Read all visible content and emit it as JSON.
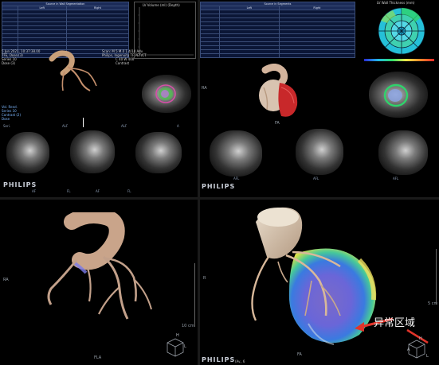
{
  "colors": {
    "background": "#000000",
    "table_bg": "#0b1636",
    "table_header": "#1b2b58",
    "annotation_arrow": "#e0342a",
    "annotation_text": "#ffffff"
  },
  "top_left": {
    "table_title": "Source in Wall Segmentation",
    "table_columns": [
      "",
      "Left",
      "Right"
    ],
    "table_rows": [
      [
        "",
        "",
        ""
      ],
      [
        "",
        "",
        ""
      ],
      [
        "",
        "",
        ""
      ],
      [
        "",
        "",
        ""
      ],
      [
        "",
        "",
        ""
      ],
      [
        "",
        "",
        ""
      ],
      [
        "",
        "",
        ""
      ],
      [
        "",
        "",
        ""
      ],
      [
        "",
        "",
        ""
      ],
      [
        "",
        "",
        ""
      ],
      [
        "",
        "",
        ""
      ],
      [
        "",
        "",
        ""
      ]
    ],
    "plot_title": "LV Volume (ml) (Depth)",
    "info_left": [
      "5 Jun 2021, 10:37:38.00",
      "TFE, Dose (3)",
      "Series 10",
      "Dose (3)"
    ],
    "info_right": [
      "Scan: M 5 M.0 1.4/14 Adv",
      "Philips, Ingenuity TF PET/CT",
      "C 40 W 400",
      "Contrast"
    ],
    "side_labels": [
      "Vol. Rend.",
      "Series 10",
      "Contrast (2)",
      "Dose"
    ],
    "view_labels": [
      "Seri.",
      "ALF",
      "ALF",
      "A"
    ],
    "bottom_labels": [
      "AF",
      "FL",
      "AF",
      "FL"
    ],
    "philips": "PHILIPS"
  },
  "top_right": {
    "table_title": "Source in Segments",
    "table_columns": [
      "",
      "Left",
      "Right"
    ],
    "bullseye_title": "LV Wall Thickness (mm)",
    "label_fa": "FA",
    "side_label": "RA",
    "view_labels": [
      "AFL",
      "AFL",
      "AFL",
      "AFL"
    ],
    "philips": "PHILIPS"
  },
  "bottom_left": {
    "side_label": "RA",
    "view_label": "FLA",
    "scale_label": "10 cm",
    "cube_top": "H",
    "cube_side": "L"
  },
  "bottom_right": {
    "side_label": "R",
    "view_label": "FA",
    "scale_label": "5 cm",
    "philips": "PHILIPS",
    "footer_text": "(Av., 6",
    "annotation": "异常区域",
    "cube_top": "H",
    "cube_side": "A",
    "cube_side2": "L"
  }
}
